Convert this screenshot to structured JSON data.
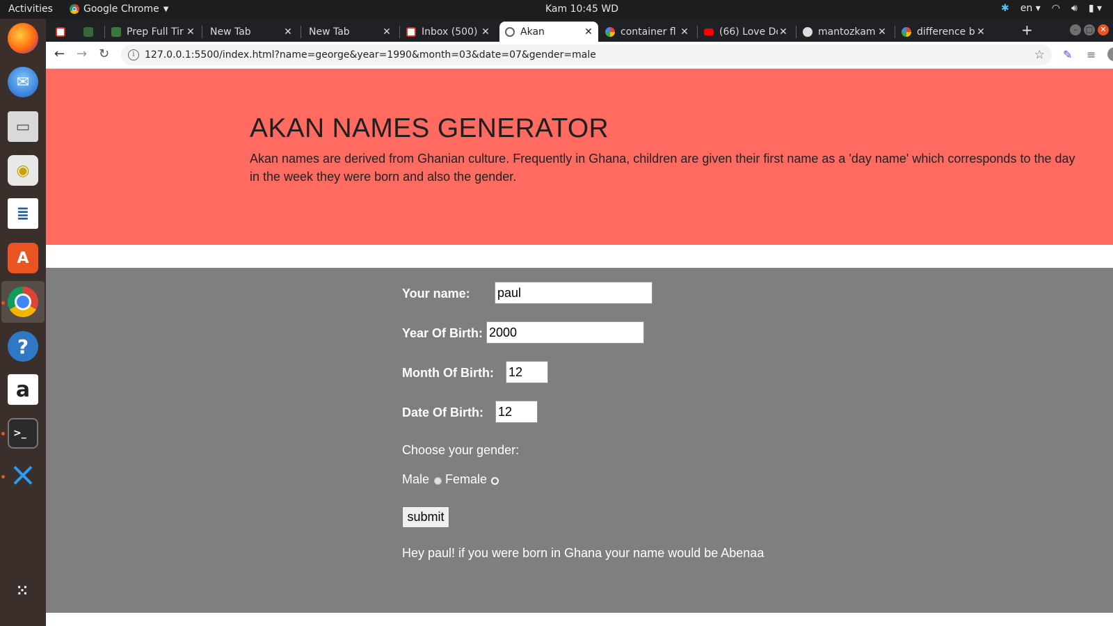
{
  "system": {
    "activities": "Activities",
    "app_name": "Google Chrome",
    "clock": "Kam 10:45 WD",
    "lang": "en"
  },
  "dock": {
    "apps": [
      "firefox-icon",
      "thunderbird-icon",
      "files-icon",
      "rhythmbox-icon",
      "writer-icon",
      "software-icon",
      "chrome-icon",
      "help-icon",
      "amazon-icon",
      "terminal-icon",
      "vscode-icon",
      "app-grid-icon"
    ]
  },
  "browser": {
    "tabs": [
      {
        "title": "",
        "icon": "gmail-icon",
        "color": "#d93025"
      },
      {
        "title": "",
        "icon": "tab-icon",
        "color": "#4caf50"
      },
      {
        "title": "Prep Full Tir",
        "icon": "tab-icon",
        "color": "#4caf50"
      },
      {
        "title": "New Tab",
        "icon": "",
        "color": ""
      },
      {
        "title": "New Tab",
        "icon": "",
        "color": ""
      },
      {
        "title": "Inbox (500)",
        "icon": "gmail-icon",
        "color": "#d93025"
      },
      {
        "title": "Akan",
        "icon": "globe-icon",
        "color": "#5f6368"
      },
      {
        "title": "container fl",
        "icon": "google-icon",
        "color": "#4285f4"
      },
      {
        "title": "(66) Love Do",
        "icon": "youtube-icon",
        "color": "#ff0000"
      },
      {
        "title": "mantozkam",
        "icon": "github-icon",
        "color": "#dddddd"
      },
      {
        "title": "difference b",
        "icon": "google-icon",
        "color": "#4285f4"
      }
    ],
    "url": "127.0.0.1:5500/index.html?name=george&year=1990&month=03&date=07&gender=male"
  },
  "page": {
    "title": "AKAN NAMES GENERATOR",
    "description": "Akan names are derived from Ghanian culture. Frequently in Ghana, children are given their first name as a 'day name' which corresponds to the day in the week they were born and also the gender.",
    "form": {
      "name_label": "Your name:",
      "name_value": "paul",
      "year_label": "Year Of Birth:",
      "year_value": "2000",
      "month_label": "Month Of Birth:",
      "month_value": "12",
      "date_label": "Date Of Birth:",
      "date_value": "12",
      "gender_prompt": "Choose your gender:",
      "male_label": "Male",
      "female_label": "Female",
      "submit_label": "submit"
    },
    "result": "Hey paul! if you were born in Ghana your name would be Abenaa"
  },
  "colors": {
    "hero_bg": "#ff6b61",
    "form_bg": "#7f7f7f"
  }
}
